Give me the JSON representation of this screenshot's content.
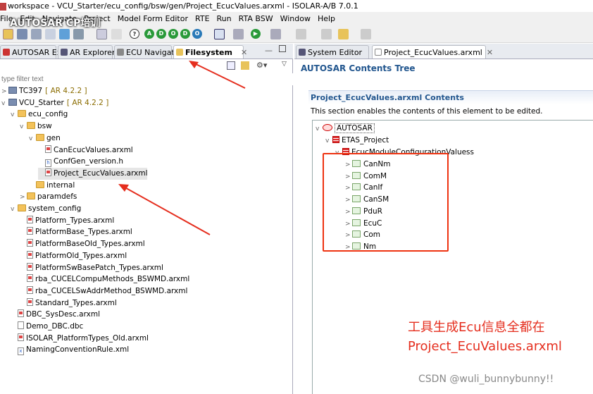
{
  "window": {
    "title": "workspace - VCU_Starter/ecu_config/bsw/gen/Project_EcucValues.arxml - ISOLAR-A/B 7.0.1"
  },
  "watermark": "AUTOSAR CP培训",
  "menu": {
    "items": [
      "File",
      "Edit",
      "Navigate",
      "Project",
      "Model Form Editor",
      "RTE",
      "Run",
      "RTA BSW",
      "Window",
      "Help"
    ]
  },
  "toolbar": {
    "circle_buttons": [
      "A",
      "D",
      "O",
      "D",
      "O"
    ]
  },
  "left": {
    "tabs": [
      "AUTOSAR Ex",
      "AR Explorer",
      "ECU Navigat",
      "Filesystem"
    ],
    "filter_placeholder": "type filter text",
    "tree": [
      {
        "label": "TC397",
        "suffix": "[ AR 4.2.2 ]",
        "kind": "proj",
        "depth": 0,
        "expander": ">"
      },
      {
        "label": "VCU_Starter",
        "suffix": "[ AR 4.2.2 ]",
        "kind": "proj",
        "depth": 0,
        "expander": "v"
      },
      {
        "label": "ecu_config",
        "suffix": "",
        "kind": "folder",
        "depth": 1,
        "expander": "v"
      },
      {
        "label": "bsw",
        "suffix": "",
        "kind": "folder",
        "depth": 2,
        "expander": "v"
      },
      {
        "label": "gen",
        "suffix": "",
        "kind": "folder",
        "depth": 3,
        "expander": "v"
      },
      {
        "label": "CanEcucValues.arxml",
        "suffix": "",
        "kind": "file",
        "depth": 4,
        "expander": ""
      },
      {
        "label": "ConfGen_version.h",
        "suffix": "",
        "kind": "hfile",
        "depth": 4,
        "expander": ""
      },
      {
        "label": "Project_EcucValues.arxml",
        "suffix": "",
        "kind": "file",
        "depth": 4,
        "expander": "",
        "selected": true
      },
      {
        "label": "internal",
        "suffix": "",
        "kind": "folder",
        "depth": 3,
        "expander": ""
      },
      {
        "label": "paramdefs",
        "suffix": "",
        "kind": "folder",
        "depth": 2,
        "expander": ">"
      },
      {
        "label": "system_config",
        "suffix": "",
        "kind": "folder",
        "depth": 1,
        "expander": "v"
      },
      {
        "label": "Platform_Types.arxml",
        "suffix": "",
        "kind": "file",
        "depth": 2,
        "expander": ""
      },
      {
        "label": "PlatformBase_Types.arxml",
        "suffix": "",
        "kind": "file",
        "depth": 2,
        "expander": ""
      },
      {
        "label": "PlatformBaseOld_Types.arxml",
        "suffix": "",
        "kind": "file",
        "depth": 2,
        "expander": ""
      },
      {
        "label": "PlatformOld_Types.arxml",
        "suffix": "",
        "kind": "file",
        "depth": 2,
        "expander": ""
      },
      {
        "label": "PlatformSwBasePatch_Types.arxml",
        "suffix": "",
        "kind": "file",
        "depth": 2,
        "expander": ""
      },
      {
        "label": "rba_CUCELCompuMethods_BSWMD.arxml",
        "suffix": "",
        "kind": "file",
        "depth": 2,
        "expander": ""
      },
      {
        "label": "rba_CUCELSwAddrMethod_BSWMD.arxml",
        "suffix": "",
        "kind": "file",
        "depth": 2,
        "expander": ""
      },
      {
        "label": "Standard_Types.arxml",
        "suffix": "",
        "kind": "file",
        "depth": 2,
        "expander": ""
      },
      {
        "label": "DBC_SysDesc.arxml",
        "suffix": "",
        "kind": "file",
        "depth": 1,
        "expander": ""
      },
      {
        "label": "Demo_DBC.dbc",
        "suffix": "",
        "kind": "plain",
        "depth": 1,
        "expander": ""
      },
      {
        "label": "ISOLAR_PlatformTypes_Old.arxml",
        "suffix": "",
        "kind": "file",
        "depth": 1,
        "expander": ""
      },
      {
        "label": "NamingConventionRule.xml",
        "suffix": "",
        "kind": "xml",
        "depth": 1,
        "expander": ""
      }
    ]
  },
  "right": {
    "tabs": [
      "System Editor",
      "Project_EcucValues.arxml"
    ],
    "heading": "AUTOSAR Contents Tree",
    "section_title": "Project_EcucValues.arxml Contents",
    "section_desc": "This section enables the contents of this element to be edited.",
    "tree": {
      "root": "AUTOSAR",
      "package": "ETAS_Project",
      "container": "EcucModuleConfigurationValuess",
      "modules": [
        "CanNm",
        "ComM",
        "CanIf",
        "CanSM",
        "PduR",
        "EcuC",
        "Com",
        "Nm"
      ]
    }
  },
  "annotation": {
    "line1": "工具生成Ecu信息全都在",
    "line2": "Project_EcuValues.arxml"
  },
  "credit": "CSDN @wuli_bunnybunny!!"
}
